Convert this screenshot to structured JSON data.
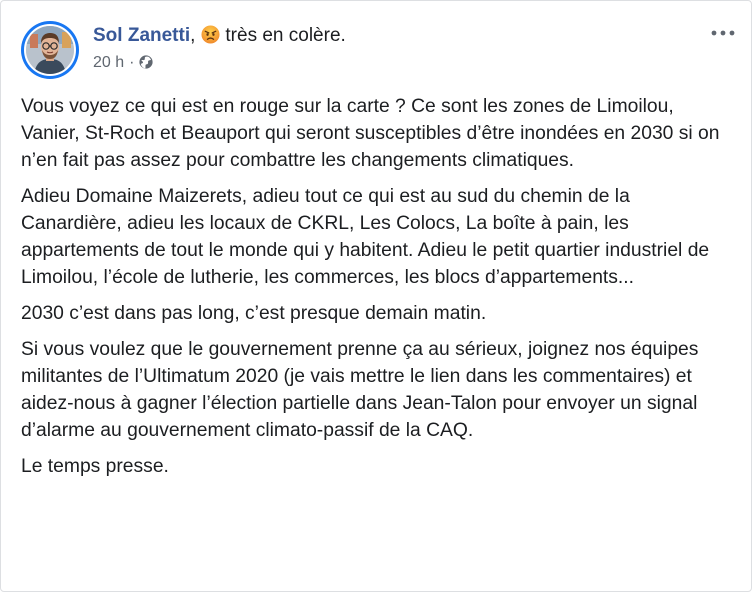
{
  "post": {
    "author": "Sol Zanetti",
    "author_separator": ",",
    "feeling": "très en colère.",
    "feeling_emoji": "angry-face-icon",
    "timestamp": "20 h",
    "meta_separator": "·",
    "audience_icon": "globe-icon",
    "more_icon": "more-options-icon",
    "paragraphs": [
      "Vous voyez ce qui est en rouge sur la carte ? Ce sont les zones de Limoilou, Vanier, St-Roch et Beauport qui seront susceptibles d’être inondées en 2030 si on n’en fait pas assez pour combattre les changements climatiques.",
      "Adieu Domaine Maizerets, adieu tout ce qui est au sud du chemin de la Canardière, adieu les locaux de CKRL, Les Colocs, La boîte à pain, les appartements de tout le monde qui y habitent. Adieu le petit quartier industriel de Limoilou, l’école de lutherie, les commerces, les blocs d’appartements...",
      "2030 c’est dans pas long, c’est presque demain matin.",
      "Si vous voulez que le gouvernement prenne ça au sérieux, joignez nos équipes militantes de l’Ultimatum 2020 (je vais mettre le lien dans les commentaires) et aidez-nous à gagner l’élection partielle dans Jean-Talon pour envoyer un signal d’alarme au gouvernement climato-passif de la CAQ.",
      "Le temps presse."
    ]
  },
  "colors": {
    "author_link": "#385898",
    "text": "#1c1e21",
    "meta": "#606770",
    "avatar_ring": "#1877f2",
    "border": "#dddfe2"
  }
}
